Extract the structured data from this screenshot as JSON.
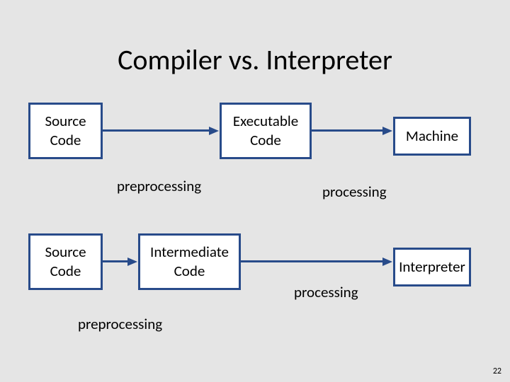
{
  "title": "Compiler vs. Interpreter",
  "row1": {
    "source_l1": "Source",
    "source_l2": "Code",
    "exec_l1": "Executable",
    "exec_l2": "Code",
    "machine": "Machine",
    "preproc": "preprocessing",
    "proc": "processing"
  },
  "row2": {
    "source_l1": "Source",
    "source_l2": "Code",
    "inter_l1": "Intermediate",
    "inter_l2": "Code",
    "interp": "Interpreter",
    "preproc": "preprocessing",
    "proc": "processing"
  },
  "page_number": "22"
}
